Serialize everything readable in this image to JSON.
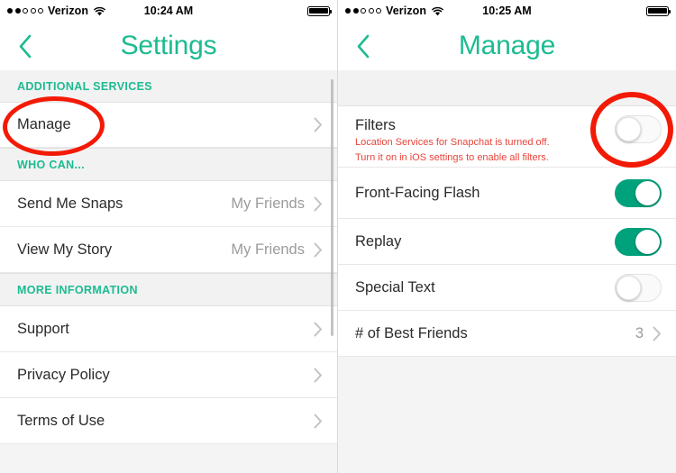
{
  "left": {
    "status": {
      "carrier": "Verizon",
      "time": "10:24 AM",
      "signal_filled": 2,
      "signal_total": 5,
      "wifi_icon": "wifi-icon",
      "battery_icon": "battery-full-icon"
    },
    "nav": {
      "title": "Settings",
      "back_icon": "chevron-left-icon"
    },
    "sections": [
      {
        "header": "ADDITIONAL SERVICES",
        "rows": [
          {
            "label": "Manage",
            "value": "",
            "accessory": "chevron-right-icon"
          }
        ]
      },
      {
        "header": "WHO CAN...",
        "rows": [
          {
            "label": "Send Me Snaps",
            "value": "My Friends",
            "accessory": "chevron-right-icon"
          },
          {
            "label": "View My Story",
            "value": "My Friends",
            "accessory": "chevron-right-icon"
          }
        ]
      },
      {
        "header": "MORE INFORMATION",
        "rows": [
          {
            "label": "Support",
            "value": "",
            "accessory": "chevron-right-icon"
          },
          {
            "label": "Privacy Policy",
            "value": "",
            "accessory": "chevron-right-icon"
          },
          {
            "label": "Terms of Use",
            "value": "",
            "accessory": "chevron-right-icon"
          }
        ]
      }
    ]
  },
  "right": {
    "status": {
      "carrier": "Verizon",
      "time": "10:25 AM",
      "signal_filled": 2,
      "signal_total": 5,
      "wifi_icon": "wifi-icon",
      "battery_icon": "battery-full-icon"
    },
    "nav": {
      "title": "Manage",
      "back_icon": "chevron-left-icon"
    },
    "rows": {
      "filters": {
        "label": "Filters",
        "warning_line1": "Location Services for Snapchat is turned off.",
        "warning_line2": "Turn it on in iOS settings to enable all filters.",
        "toggle_state": "off"
      },
      "front_facing_flash": {
        "label": "Front-Facing Flash",
        "toggle_state": "on"
      },
      "replay": {
        "label": "Replay",
        "toggle_state": "on"
      },
      "special_text": {
        "label": "Special Text",
        "toggle_state": "off"
      },
      "best_friends": {
        "label": "# of Best Friends",
        "value": "3",
        "accessory": "chevron-right-icon"
      }
    }
  },
  "annotations": {
    "color": "#f31a05",
    "manage_highlight": "red-ellipse-around-manage",
    "filters_toggle_highlight": "red-circle-around-filters-toggle"
  },
  "theme": {
    "accent_teal": "#1dbb91",
    "toggle_on_green": "#00a27c",
    "warning_red": "#e8443a",
    "row_bg": "#ffffff",
    "section_bg": "#f2f2f2"
  }
}
